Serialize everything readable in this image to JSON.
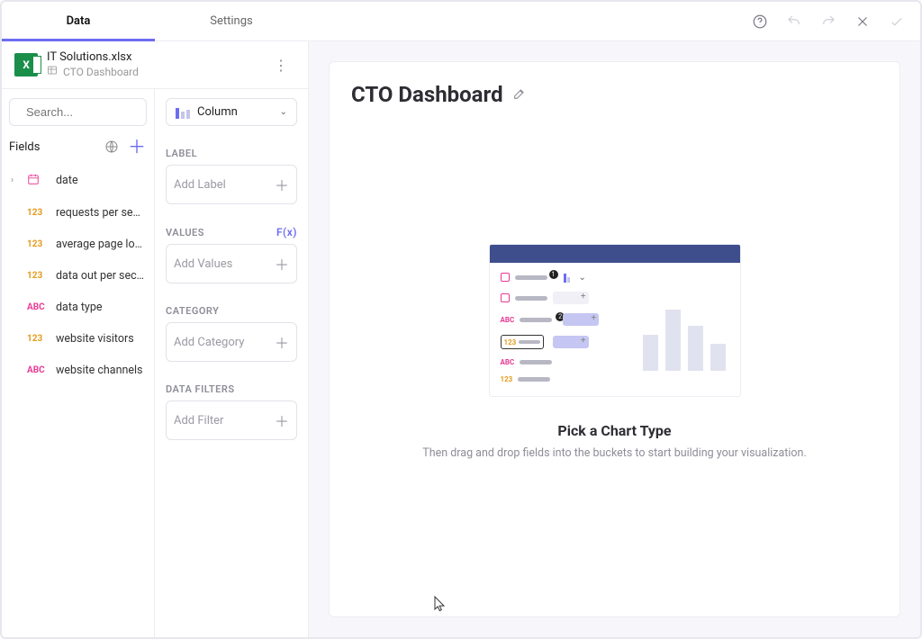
{
  "tabs": {
    "data": "Data",
    "settings": "Settings"
  },
  "file": {
    "name": "IT Solutions.xlsx",
    "sheet": "CTO Dashboard"
  },
  "search": {
    "placeholder": "Search..."
  },
  "fields": {
    "label": "Fields",
    "items": [
      {
        "type": "date",
        "label": "date"
      },
      {
        "type": "num",
        "label": "requests per se…"
      },
      {
        "type": "num",
        "label": "average page lo…"
      },
      {
        "type": "num",
        "label": "data out per sec…"
      },
      {
        "type": "abc",
        "label": "data type"
      },
      {
        "type": "num",
        "label": "website visitors"
      },
      {
        "type": "abc",
        "label": "website channels"
      }
    ]
  },
  "chart_type": {
    "name": "Column"
  },
  "config": {
    "label_section": "LABEL",
    "label_placeholder": "Add Label",
    "values_section": "VALUES",
    "fx_label": "F(x)",
    "values_placeholder": "Add Values",
    "category_section": "CATEGORY",
    "category_placeholder": "Add Category",
    "filters_section": "DATA FILTERS",
    "filters_placeholder": "Add Filter"
  },
  "dashboard": {
    "title": "CTO Dashboard",
    "empty_title": "Pick a Chart Type",
    "empty_subtitle": "Then drag and drop fields into the buckets to start building your visualization."
  },
  "type_tokens": {
    "num": "123",
    "abc": "ABC"
  }
}
